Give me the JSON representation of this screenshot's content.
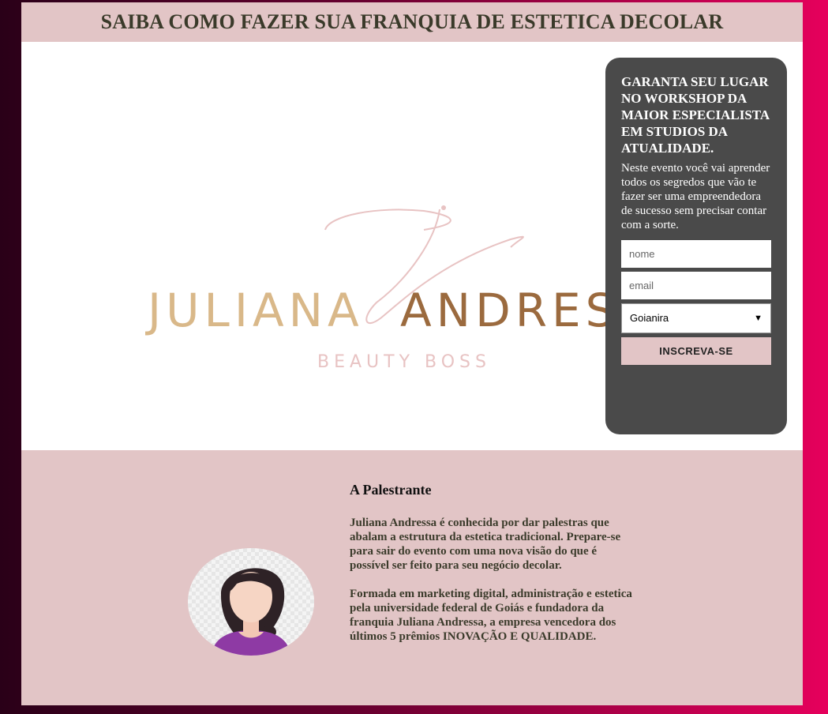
{
  "header": {
    "title": "SAIBA COMO FAZER SUA FRANQUIA DE ESTETICA DECOLAR"
  },
  "logo": {
    "monogram": "j",
    "name_first": "JULIANA",
    "name_second": "ANDRESSA",
    "tagline": "BEAUTY BOSS",
    "colors": {
      "gold": "#d9b889",
      "bronze": "#9b6a3e",
      "pink": "#e8c3c3"
    }
  },
  "form": {
    "heading": "GARANTA SEU LUGAR NO WORKSHOP DA MAIOR ESPECIALISTA EM STUDIOS DA ATUALIDADE.",
    "description": "Neste evento você vai aprender todos os segredos que vão te fazer ser uma empreendedora de sucesso sem precisar contar com a sorte.",
    "name_placeholder": "nome",
    "email_placeholder": "email",
    "city_selected": "Goianira",
    "submit_label": "INSCREVA-SE"
  },
  "speaker": {
    "heading": "A Palestrante",
    "paragraph_1": "Juliana Andressa é conhecida por dar palestras que abalam a estrutura da estetica tradicional. Prepare-se para sair do evento com uma nova visão do que é possível ser feito para seu negócio decolar.",
    "paragraph_2": "Formada em marketing digital, administração e estetica pela universidade federal de Goiás e fundadora da franquia Juliana Andressa, a empresa vencedora dos últimos 5 prêmios INOVAÇÃO E QUALIDADE."
  },
  "colors": {
    "accent_pink": "#e2c5c6",
    "card_gray": "#4a4a4a",
    "brand_magenta": "#e6005c"
  }
}
